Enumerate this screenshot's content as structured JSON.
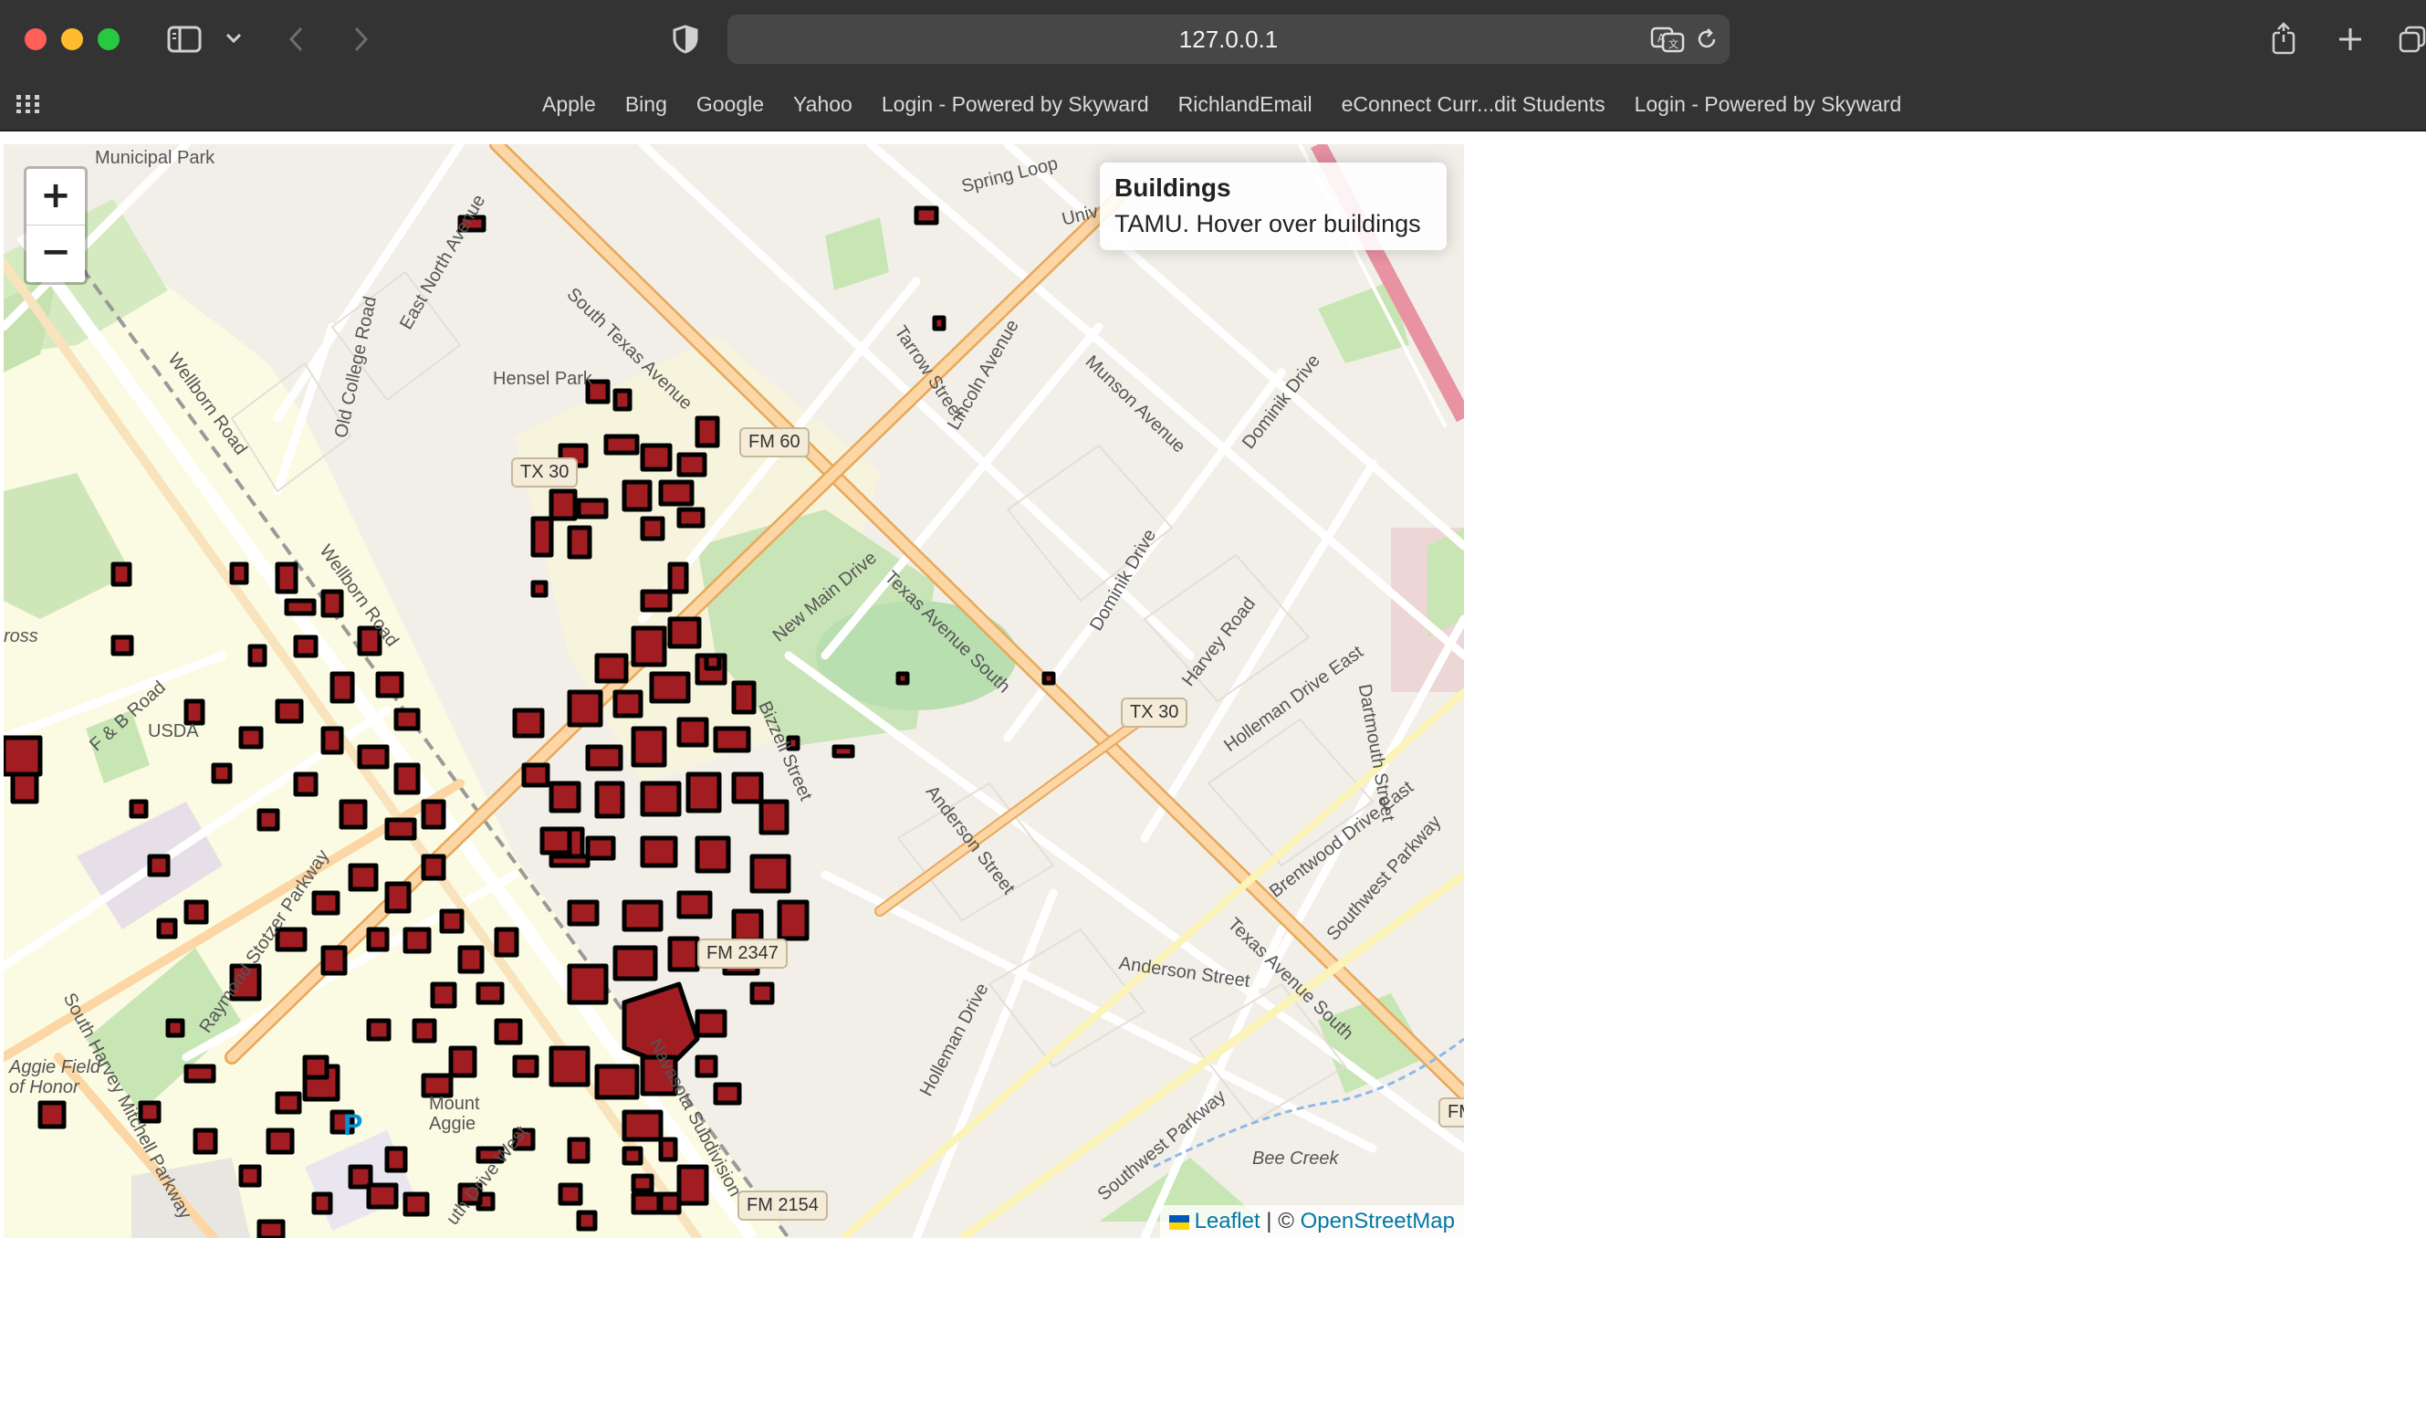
{
  "browser": {
    "url": "127.0.0.1",
    "bookmarks": [
      "Apple",
      "Bing",
      "Google",
      "Yahoo",
      "Login - Powered by Skyward",
      "RichlandEmail",
      "eConnect Curr...dit Students",
      "Login - Powered by Skyward"
    ],
    "traffic_light_colors": [
      "#ff5f57",
      "#febc2e",
      "#28c840"
    ],
    "icons": [
      "sidebar-icon",
      "chevron-down-icon",
      "back-icon",
      "forward-icon",
      "shield-icon",
      "translate-icon",
      "reload-icon",
      "share-icon",
      "new-tab-icon",
      "tab-overview-icon",
      "grid-icon"
    ]
  },
  "map": {
    "zoom_in_label": "+",
    "zoom_out_label": "−",
    "info": {
      "title": "Buildings",
      "subtitle": "TAMU. Hover over buildings"
    },
    "attribution": {
      "leaflet": "Leaflet",
      "separator": "| ©",
      "osm": "OpenStreetMap"
    },
    "labels": {
      "municipal_park": "Municipal Park",
      "spring_loop": "Spring Loop",
      "univ": "Univ",
      "east_north_avenue": "East North Avenue",
      "south_texas_avenue": "South Texas Avenue",
      "old_college_road": "Old College Road",
      "wellborn_road_1": "Wellborn Road",
      "wellborn_road_2": "Wellborn Road",
      "hensel_park": "Hensel Park",
      "tarrow_street": "Tarrow Street",
      "lincoln_avenue": "Lincoln Avenue",
      "munson_avenue": "Munson Avenue",
      "dominik_drive_1": "Dominik Drive",
      "dominik_drive_2": "Dominik Drive",
      "new_main_drive": "New Main Drive",
      "texas_avenue_south_1": "Texas Avenue South",
      "texas_avenue_south_2": "Texas Avenue South",
      "harvey_road": "Harvey Road",
      "holleman_drive_east": "Holleman Drive East",
      "dartmouth_street": "Dartmouth Street",
      "brentwood_drive_east": "Brentwood Drive East",
      "southwest_parkway_1": "Southwest Parkway",
      "southwest_parkway_2": "Southwest Parkway",
      "f_b_road": "F & B Road",
      "usda": "USDA",
      "bizzell_street": "Bizzell Street",
      "anderson_street_1": "Anderson Street",
      "anderson_street_2": "Anderson Street",
      "raymond_stotzer": "Raymond Stotzer Parkway",
      "south_harvey_mitchell": "South Harvey Mitchell Parkway",
      "aggie_field": "Aggie Field of Honor",
      "mount_aggie": "Mount Aggie",
      "navasota_subdivision": "Navasota Subdivision",
      "holleman_drive": "Holleman Drive",
      "bee_creek": "Bee Creek",
      "drive_west": "uth Drive West",
      "cross": "ross",
      "parking": "P",
      "fm_edge": "FM"
    },
    "shields": {
      "fm60": "FM 60",
      "tx30_a": "TX 30",
      "tx30_b": "TX 30",
      "fm2347": "FM 2347",
      "fm2154": "FM 2154"
    },
    "colors": {
      "building_fill": "#a11d22",
      "building_stroke": "#000000",
      "park": "#c8e6b3",
      "campus": "#fdfbe0",
      "major_road": "#fcd6a4",
      "major_road_edge": "#e8a85a",
      "railway": "#888888",
      "highway": "#e892a2"
    }
  }
}
